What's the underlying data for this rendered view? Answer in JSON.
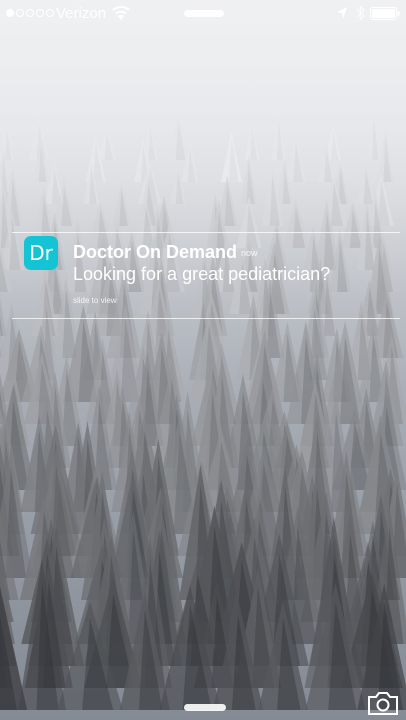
{
  "status_bar": {
    "carrier": "Verizon",
    "signal_bars_filled": 1,
    "signal_bars_total": 5,
    "icons": [
      "wifi-icon",
      "location-icon",
      "bluetooth-icon",
      "battery-icon"
    ]
  },
  "notification": {
    "app_icon_text": "Dr",
    "app_icon_color": "#14c4d4",
    "app_name": "Doctor On Demand",
    "time": "now",
    "message": "Looking for a great pediatrician?",
    "action_hint": "slide to view"
  },
  "bottom": {
    "icons": [
      "home-grabber",
      "camera-icon"
    ]
  }
}
